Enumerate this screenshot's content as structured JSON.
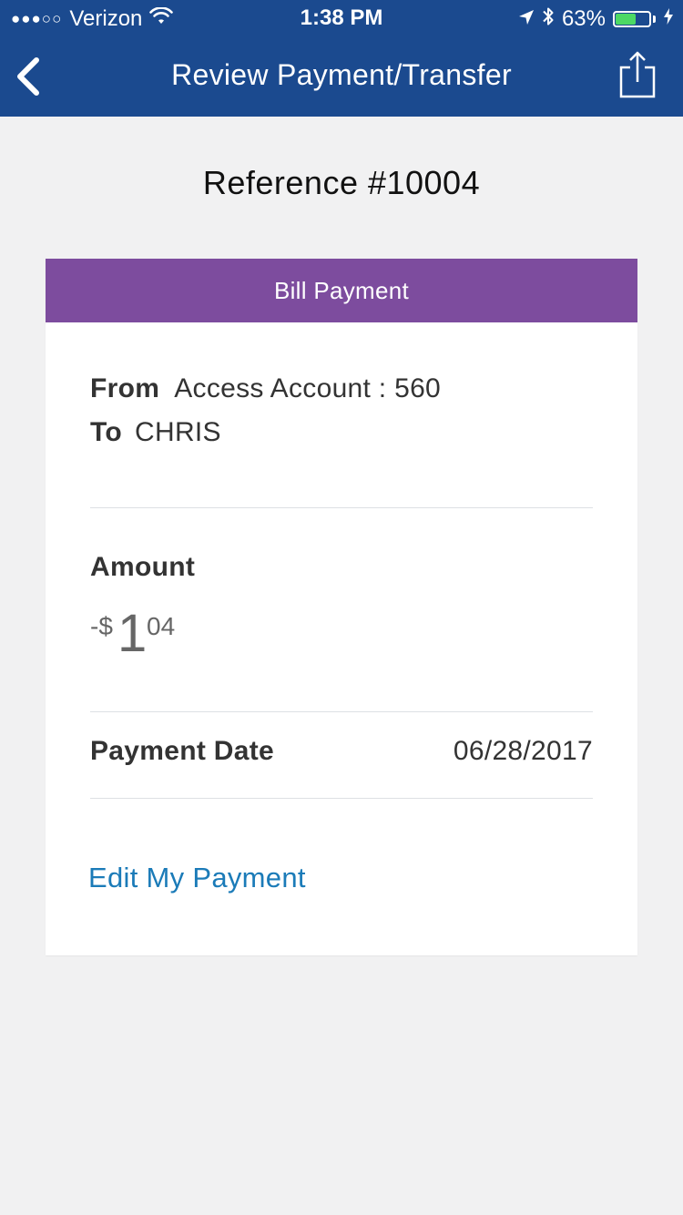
{
  "status_bar": {
    "signal": "●●●○○",
    "carrier": "Verizon",
    "time": "1:38 PM",
    "battery_text": "63%",
    "battery_level": 0.63,
    "battery_color": "#4cd964"
  },
  "nav": {
    "title": "Review Payment/Transfer",
    "back_icon": "chevron-left-icon",
    "share_icon": "share-icon",
    "background": "#1b4a8f"
  },
  "reference": {
    "label": "Reference #10004"
  },
  "card": {
    "header": "Bill Payment",
    "header_color": "#7d4c9e",
    "from_label": "From",
    "from_value": "Access Account : 560",
    "to_label": "To",
    "to_value": "CHRIS",
    "amount_label": "Amount",
    "amount_sign": "-$",
    "amount_whole": "1",
    "amount_cents": "04",
    "date_label": "Payment Date",
    "date_value": "06/28/2017",
    "edit_link": "Edit My Payment",
    "link_color": "#1b7bb8"
  }
}
